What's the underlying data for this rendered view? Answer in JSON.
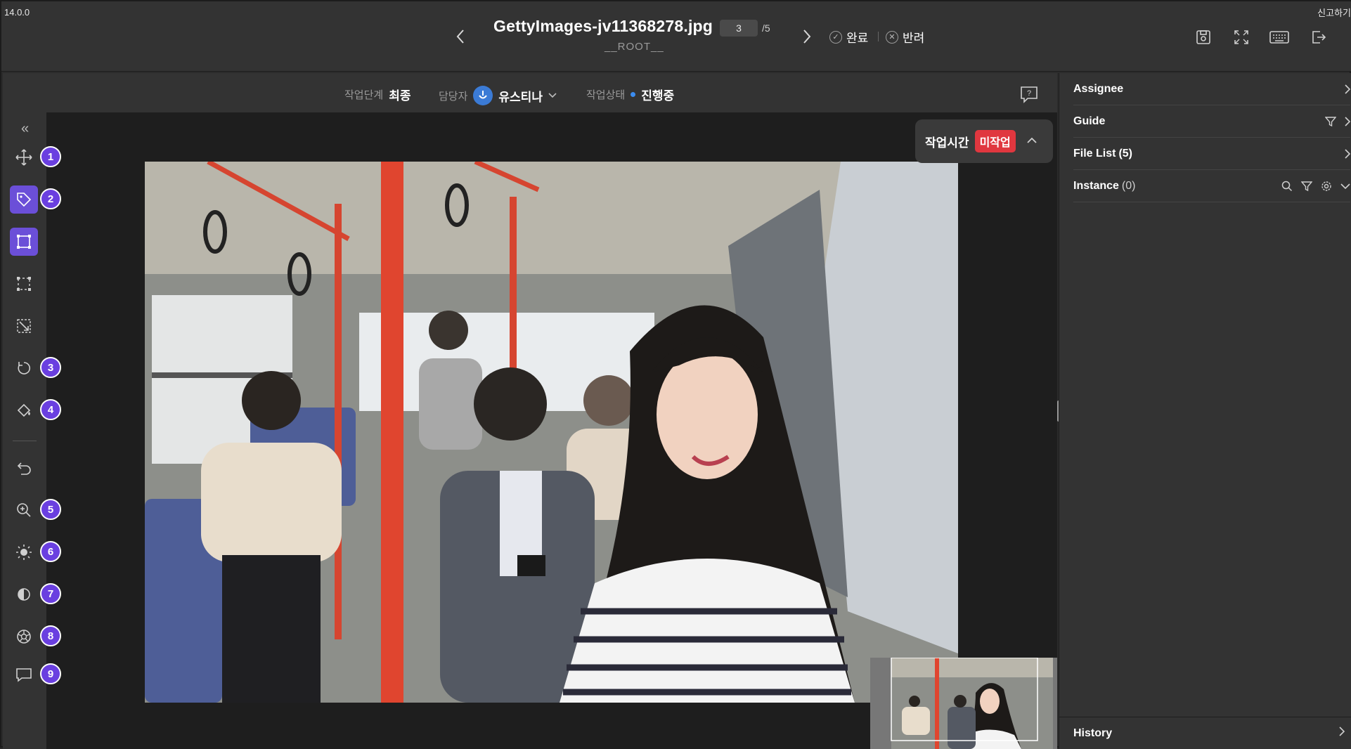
{
  "app": {
    "version": "14.0.0",
    "report_label": "신고하기"
  },
  "header": {
    "filename": "GettyImages-jv11368278.jpg",
    "folder": "__ROOT__",
    "page_current": "3",
    "page_total": "/5",
    "approve_label": "완료",
    "reject_label": "반려",
    "icons": [
      "prev-icon",
      "next-icon",
      "save-icon",
      "fullscreen-icon",
      "keyboard-icon",
      "exit-icon"
    ]
  },
  "infobar": {
    "stage_label": "작업단계",
    "stage_value": "최종",
    "assignee_label": "담당자",
    "assignee_value": "유스티나",
    "status_label": "작업상태",
    "status_value": "진행중",
    "status_color": "#3b8cf0"
  },
  "toolbar": {
    "accent": "#6b4fd8",
    "badges": [
      "1",
      "2",
      "3",
      "4",
      "5",
      "6",
      "7",
      "8",
      "9"
    ],
    "tools": [
      "pan-icon",
      "tag-icon",
      "bbox-icon",
      "polygon-icon",
      "crop-icon",
      "rotate-icon",
      "fill-icon",
      "undo-icon",
      "zoom-icon",
      "brightness-icon",
      "contrast-icon",
      "settings-icon",
      "comment-icon"
    ]
  },
  "timer": {
    "label": "작업시간",
    "status": "미작업",
    "status_color": "#e0373f"
  },
  "rpanel": {
    "assignee": "Assignee",
    "guide": "Guide",
    "file_list": "File List",
    "file_list_count": "(5)",
    "instance": "Instance",
    "instance_count": "(0)",
    "history": "History"
  }
}
